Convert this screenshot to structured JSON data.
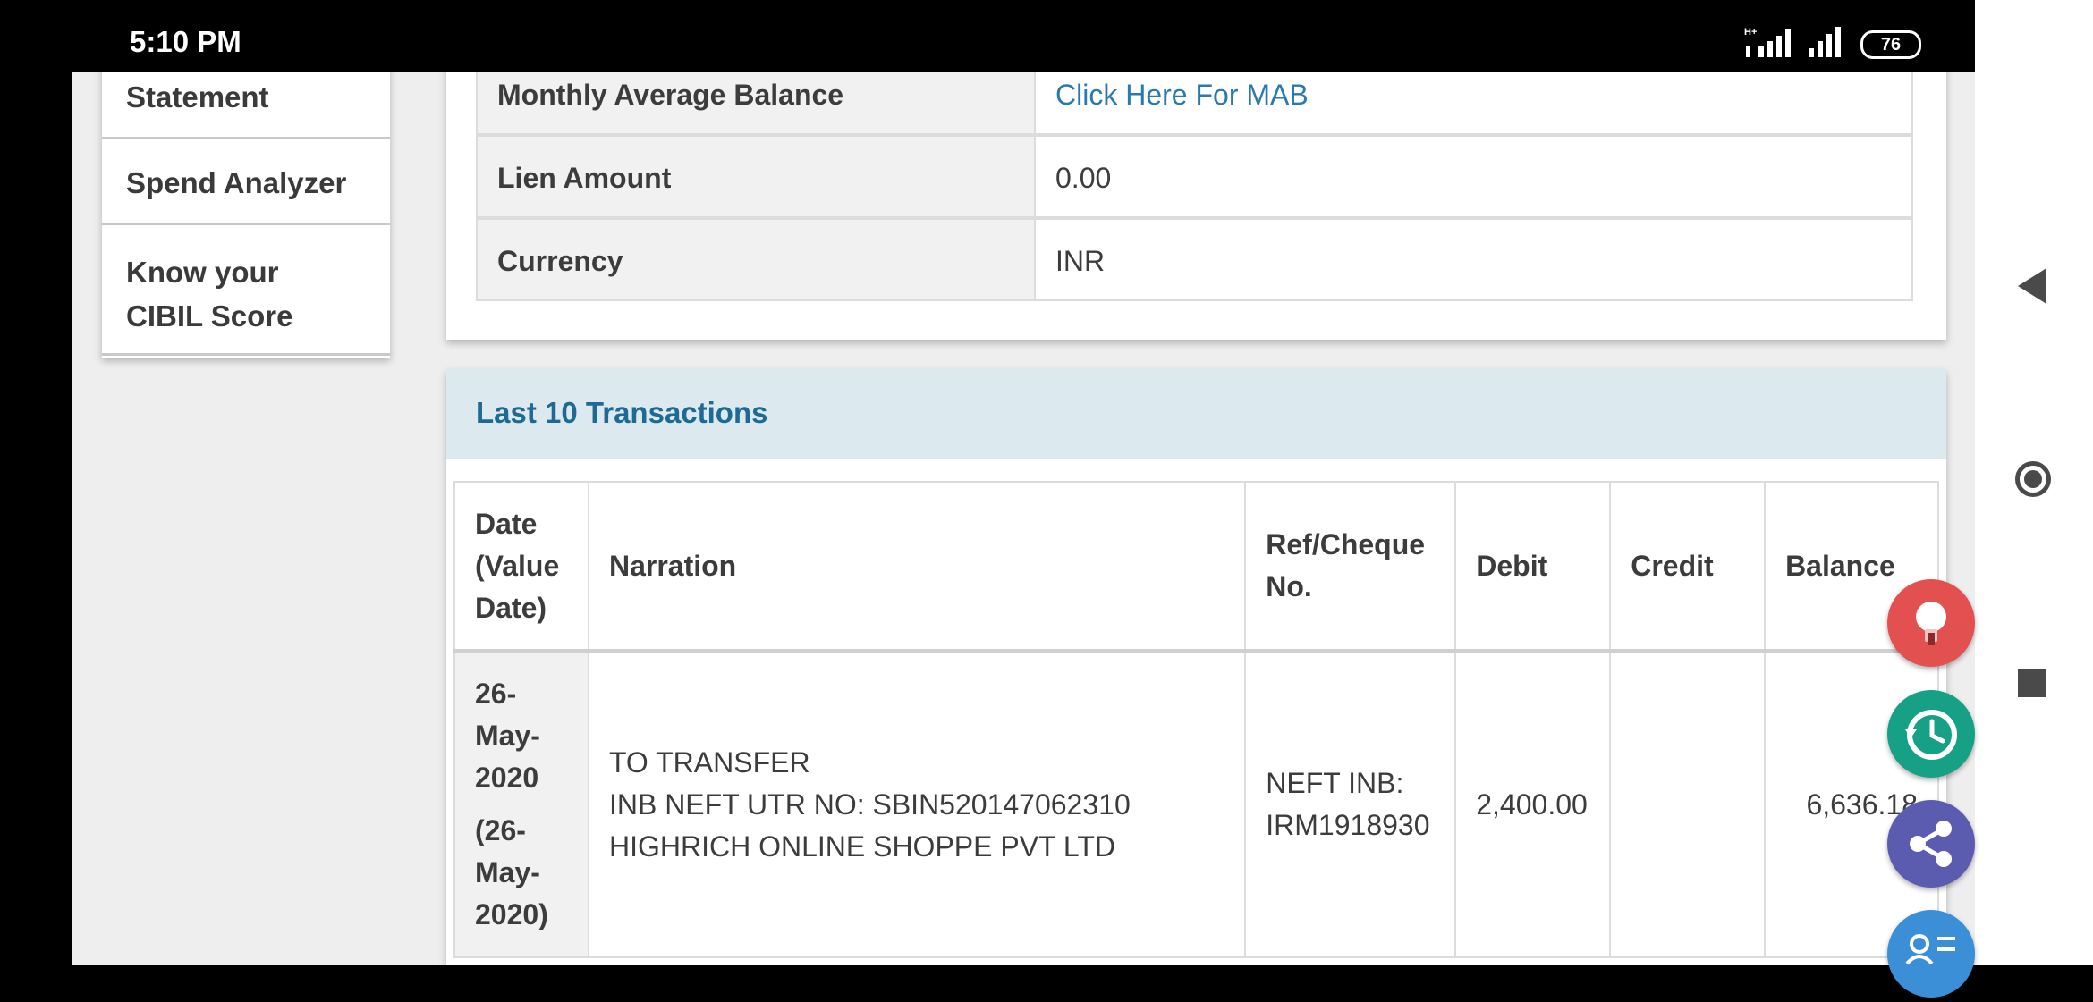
{
  "status_bar": {
    "time": "5:10 PM",
    "battery": "76"
  },
  "sidebar": {
    "items": [
      "Statement",
      "Spend Analyzer",
      "Know your CIBIL Score"
    ]
  },
  "account_details": [
    {
      "label": "Monthly Average Balance",
      "value": "Click Here For MAB"
    },
    {
      "label": "Lien Amount",
      "value": "0.00"
    },
    {
      "label": "Currency",
      "value": "INR"
    }
  ],
  "transactions": {
    "title": "Last 10 Transactions",
    "columns": [
      "Date (Value Date)",
      "Narration",
      "Ref/Cheque No.",
      "Debit",
      "Credit",
      "Balance"
    ],
    "rows": [
      {
        "date": "26-May-2020",
        "value_date": "(26-May-2020)",
        "narration_1": "TO TRANSFER",
        "narration_2": "INB NEFT UTR NO: SBIN520147062310",
        "narration_3": "HIGHRICH ONLINE SHOPPE PVT LTD",
        "ref_1": "NEFT INB:",
        "ref_2": "IRM1918930",
        "debit": "2,400.00",
        "credit": "",
        "balance": "6,636.18"
      }
    ]
  },
  "colors": {
    "link": "#2a7ab0",
    "header_bg": "#dceaf0",
    "header_text": "#1f6a94"
  },
  "fabs": [
    {
      "icon": "lightbulb-icon",
      "color": "#e35050"
    },
    {
      "icon": "history-icon",
      "color": "#16a085"
    },
    {
      "icon": "share-icon",
      "color": "#5b5bb0"
    },
    {
      "icon": "contact-list-icon",
      "color": "#3a8fd6"
    }
  ]
}
